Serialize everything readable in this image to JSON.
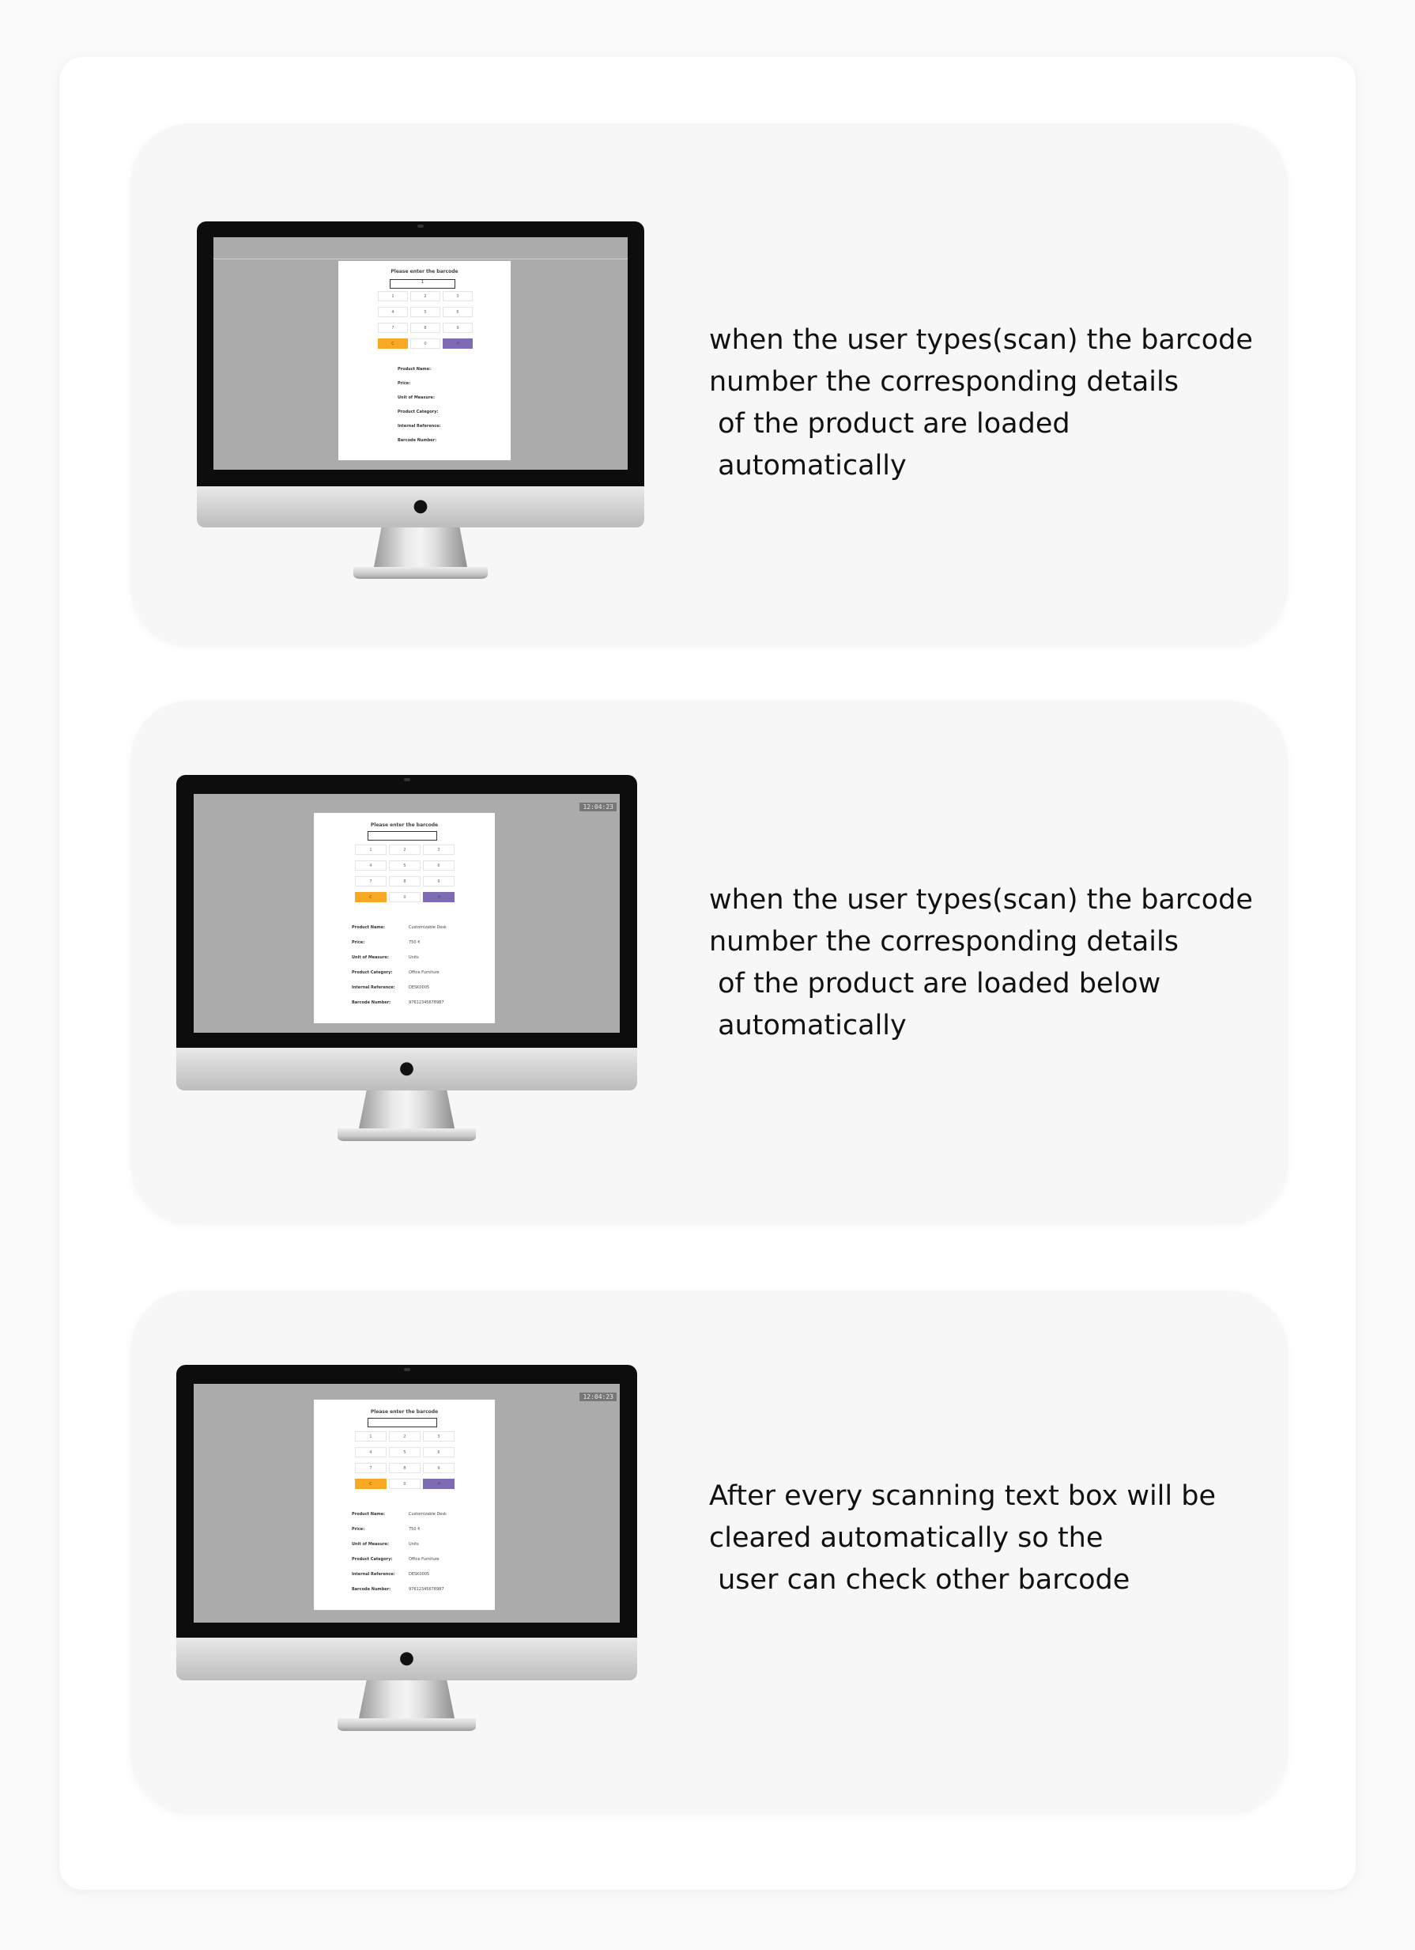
{
  "cards": [
    {
      "text_lines": [
        "when the user types(scan) the barcode",
        "number the corresponding details",
        " of the product are loaded",
        " automatically"
      ],
      "screen": {
        "title": "Please enter the barcode",
        "input_value": "1",
        "keys": [
          "1",
          "2",
          "3",
          "4",
          "5",
          "6",
          "7",
          "8",
          "9",
          "C",
          "0",
          "⏎"
        ],
        "fields": [
          {
            "label": "Product Name:",
            "value": ""
          },
          {
            "label": "Price:",
            "value": ""
          },
          {
            "label": "Unit of Measure:",
            "value": ""
          },
          {
            "label": "Product Category:",
            "value": ""
          },
          {
            "label": "Internal Reference:",
            "value": ""
          },
          {
            "label": "Barcode Number:",
            "value": ""
          }
        ]
      }
    },
    {
      "text_lines": [
        "when the user types(scan) the barcode",
        "number the corresponding details",
        " of the product are loaded below",
        " automatically"
      ],
      "screen": {
        "clock": "12:04:23",
        "title": "Please enter the barcode",
        "input_value": "",
        "keys": [
          "1",
          "2",
          "3",
          "4",
          "5",
          "6",
          "7",
          "8",
          "9",
          "C",
          "0",
          "⏎"
        ],
        "fields": [
          {
            "label": "Product Name:",
            "value": "Customizable Desk"
          },
          {
            "label": "Price:",
            "value": "750 ₹"
          },
          {
            "label": "Unit of Measure:",
            "value": "Units"
          },
          {
            "label": "Product Category:",
            "value": "Office Furniture"
          },
          {
            "label": "Internal Reference:",
            "value": "DESK0005"
          },
          {
            "label": "Barcode Number:",
            "value": "97612345678987"
          }
        ]
      }
    },
    {
      "text_lines": [
        "After every scanning text box will be",
        "cleared automatically so the",
        " user can check other barcode"
      ],
      "screen": {
        "clock": "12:04:23",
        "title": "Please enter the barcode",
        "input_value": "",
        "keys": [
          "1",
          "2",
          "3",
          "4",
          "5",
          "6",
          "7",
          "8",
          "9",
          "C",
          "0",
          "⏎"
        ],
        "fields": [
          {
            "label": "Product Name:",
            "value": "Customizable Desk"
          },
          {
            "label": "Price:",
            "value": "750 ₹"
          },
          {
            "label": "Unit of Measure:",
            "value": "Units"
          },
          {
            "label": "Product Category:",
            "value": "Office Furniture"
          },
          {
            "label": "Internal Reference:",
            "value": "DESK0005"
          },
          {
            "label": "Barcode Number:",
            "value": "97612345678987"
          }
        ]
      }
    }
  ],
  "icons": {
    "monitor_logo": "apple-logo-icon"
  }
}
